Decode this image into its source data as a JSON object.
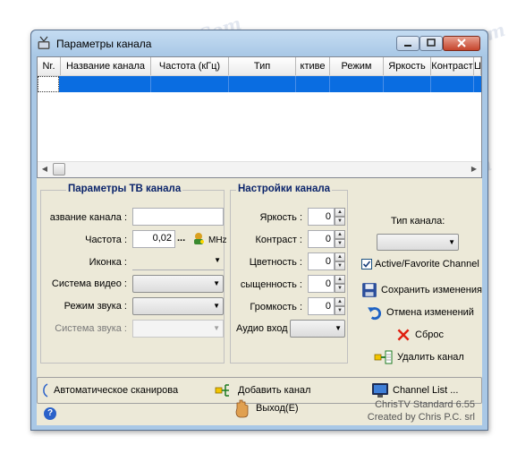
{
  "window": {
    "title": "Параметры канала"
  },
  "listview": {
    "columns": [
      "Nr.",
      "Название канала",
      "Частота (кГц)",
      "Тип",
      "ктиве",
      "Режим",
      "Яркость",
      "Контраст",
      "Ц"
    ]
  },
  "tv_params": {
    "title": "Параметры ТВ канала",
    "name_label": "азвание канала :",
    "name_value": "",
    "freq_label": "Частота :",
    "freq_value": "0,02",
    "freq_dots": "...",
    "freq_unit": "MHz",
    "icon_label": "Иконка :",
    "video_label": "Система видео :",
    "sound_mode_label": "Режим звука :",
    "sound_system_label": "Система звука :"
  },
  "channel_settings": {
    "title": "Настройки канала",
    "brightness_label": "Яркость :",
    "brightness_value": "0",
    "contrast_label": "Контраст :",
    "contrast_value": "0",
    "color_label": "Цветность :",
    "color_value": "0",
    "saturation_label": "сыщенность :",
    "saturation_value": "0",
    "volume_label": "Громкость :",
    "volume_value": "0",
    "audio_input_label": "Аудио вход"
  },
  "channel_type": {
    "label": "Тип канала:",
    "favorite_label": "Active/Favorite Channel",
    "favorite_checked": true
  },
  "actions": {
    "save": "Сохранить изменения",
    "undo": "Отмена изменений",
    "reset": "Сброс",
    "delete": "Удалить канал"
  },
  "bottom_panel": {
    "autoscan": "Автоматическое сканирова",
    "add": "Добавить канал",
    "list": "Channel List ..."
  },
  "footer": {
    "exit": "Выход(E)",
    "version": "ChrisTV Standard 6.55",
    "author": "Created by Chris P.C. srl",
    "help": "?"
  },
  "watermark": "Soringpcrepair.Com",
  "icons": {
    "app": "tv-antenna-icon",
    "freq": "tuning-icon",
    "save": "floppy-icon",
    "undo": "undo-arrow-icon",
    "reset": "red-x-icon",
    "delete": "delete-channel-icon",
    "add": "add-channel-icon",
    "list": "monitor-icon",
    "exit": "hand-exit-icon"
  }
}
